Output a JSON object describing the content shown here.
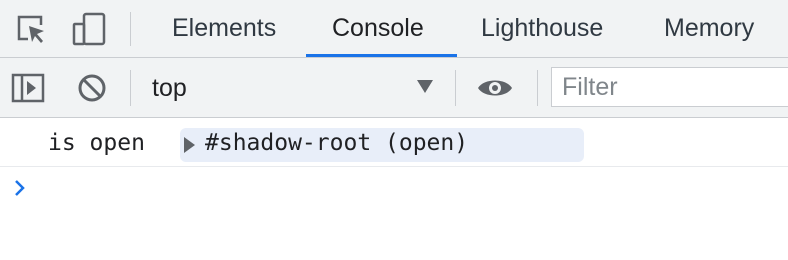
{
  "devtools": {
    "tabs": [
      {
        "label": "Elements",
        "selected": false
      },
      {
        "label": "Console",
        "selected": true
      },
      {
        "label": "Lighthouse",
        "selected": false
      },
      {
        "label": "Memory",
        "selected": false
      }
    ],
    "icons": {
      "inspect": "inspect-element-icon",
      "device": "device-toolbar-icon"
    },
    "accent_color": "#1a73e8"
  },
  "console_toolbar": {
    "context": "top",
    "filter_placeholder": "Filter",
    "filter_value": ""
  },
  "console": {
    "messages": [
      {
        "text": "is open",
        "object": "#shadow-root (open)",
        "expanded": false
      }
    ],
    "prompt_value": ""
  }
}
